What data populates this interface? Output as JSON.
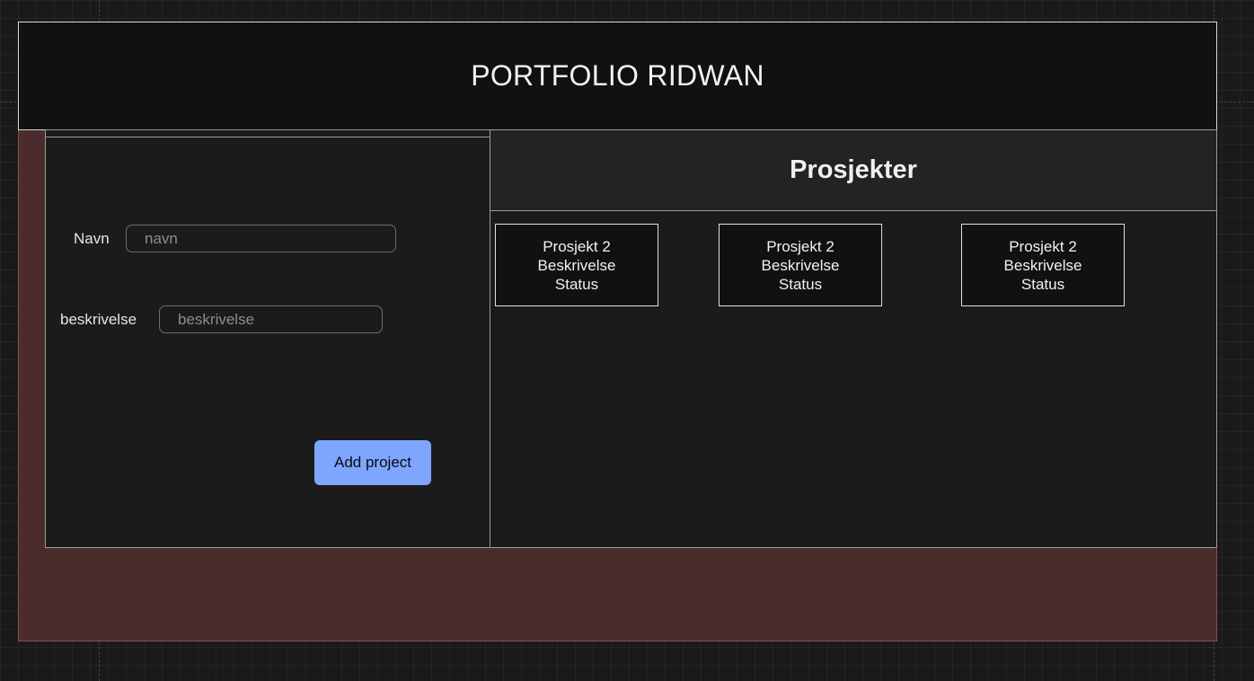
{
  "header": {
    "title": "PORTFOLIO RIDWAN"
  },
  "form": {
    "name_label": "Navn",
    "name_placeholder": "navn",
    "name_value": "",
    "description_label": "beskrivelse",
    "description_placeholder": "beskrivelse",
    "description_value": "",
    "submit_label": "Add project"
  },
  "projects": {
    "heading": "Prosjekter",
    "items": [
      {
        "name": "Prosjekt 2",
        "description": "Beskrivelse",
        "status": "Status"
      },
      {
        "name": "Prosjekt 2",
        "description": "Beskrivelse",
        "status": "Status"
      },
      {
        "name": "Prosjekt 2",
        "description": "Beskrivelse",
        "status": "Status"
      }
    ]
  },
  "colors": {
    "accent_button": "#7ea6ff",
    "header_background": "#111111",
    "panel_background": "#1b1b1b",
    "artboard_background": "#4a2c2c"
  }
}
